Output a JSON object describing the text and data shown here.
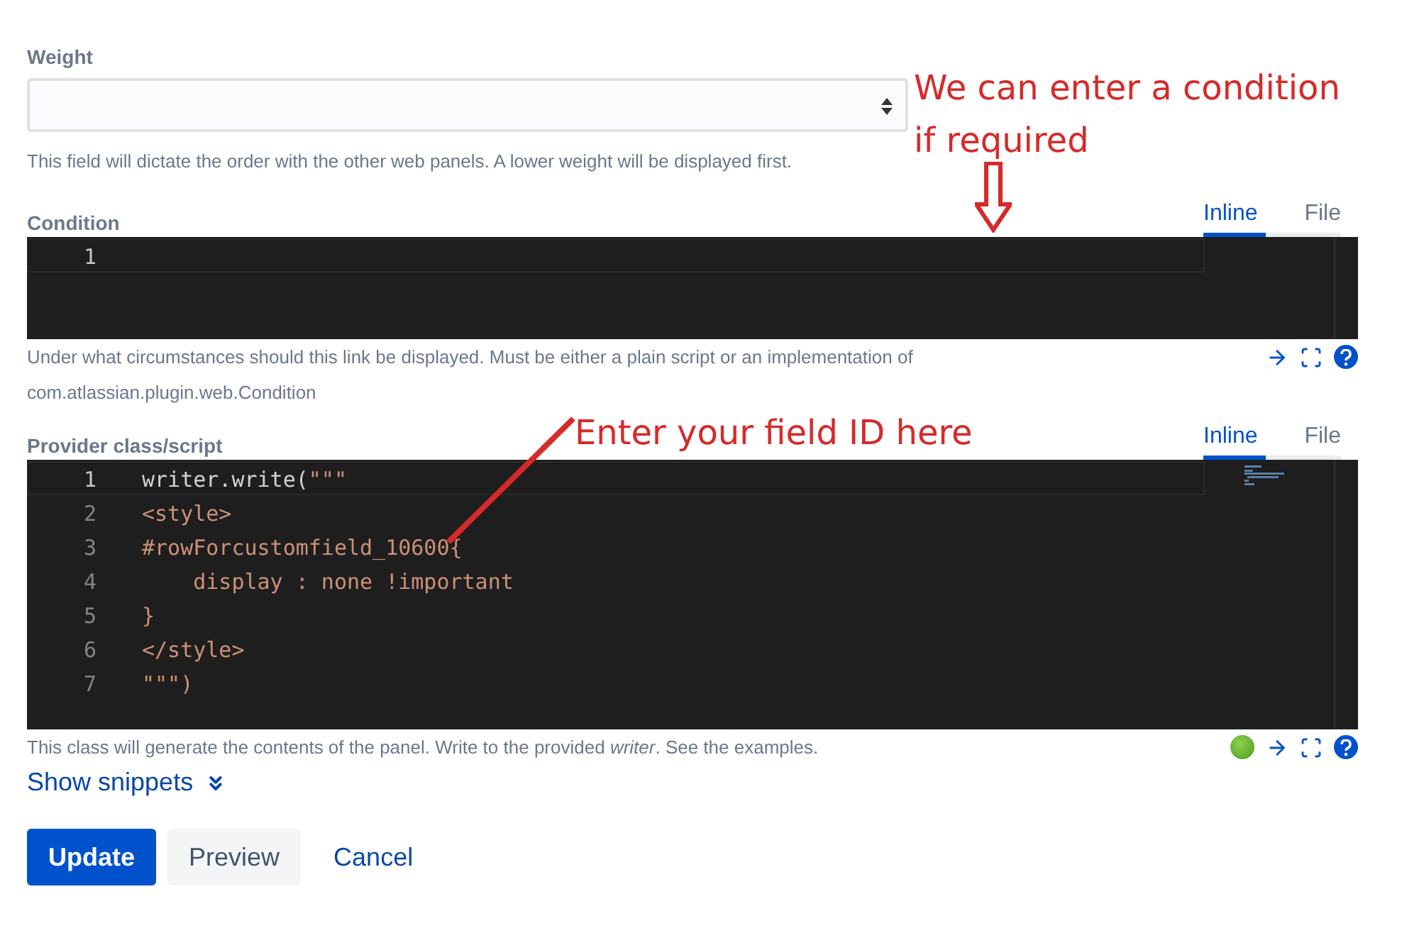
{
  "weight": {
    "label": "Weight",
    "help": "This field will dictate the order with the other web panels. A lower weight will be displayed first."
  },
  "editors": [
    {
      "label": "Condition",
      "tabs": [
        {
          "label": "Inline",
          "selected": true
        },
        {
          "label": "File",
          "selected": false
        }
      ],
      "lines": [
        {
          "number": "1"
        }
      ],
      "valid": false,
      "help": "Under what circumstances should this link be displayed. Must be either a plain script or an implementation of com.atlassian.plugin.web.Condition"
    },
    {
      "label": "Provider class/script",
      "tabs": [
        {
          "label": "Inline",
          "selected": true
        },
        {
          "label": "File",
          "selected": false
        }
      ],
      "lines": [
        {
          "number": "1",
          "segments": [
            {
              "text": "writer.write(",
              "kind": "plain"
            },
            {
              "text": "\"\"\"",
              "kind": "string"
            }
          ]
        },
        {
          "number": "2",
          "segments": [
            {
              "text": "<style>",
              "kind": "string"
            }
          ]
        },
        {
          "number": "3",
          "segments": [
            {
              "text": "#rowForcustomfield_10600{",
              "kind": "string"
            }
          ]
        },
        {
          "number": "4",
          "segments": [
            {
              "text": "    display : none !important",
              "kind": "string"
            }
          ]
        },
        {
          "number": "5",
          "segments": [
            {
              "text": "}",
              "kind": "string"
            }
          ]
        },
        {
          "number": "6",
          "segments": [
            {
              "text": "</style>",
              "kind": "string"
            }
          ]
        },
        {
          "number": "7",
          "segments": [
            {
              "text": "\"\"\")",
              "kind": "string"
            }
          ]
        }
      ],
      "valid": true,
      "help": "This class will generate the contents of the panel. Write to the provided *writer*. See the examples."
    }
  ],
  "snippets_link": "Show snippets",
  "buttons": [
    {
      "label": "Update",
      "kind": "primary"
    },
    {
      "label": "Preview",
      "kind": "default"
    },
    {
      "label": "Cancel",
      "kind": "link"
    }
  ],
  "annotations": [
    {
      "text": "We can enter a condition if required",
      "kind": "arrow"
    },
    {
      "text": "Enter your field ID here",
      "kind": "line"
    }
  ]
}
